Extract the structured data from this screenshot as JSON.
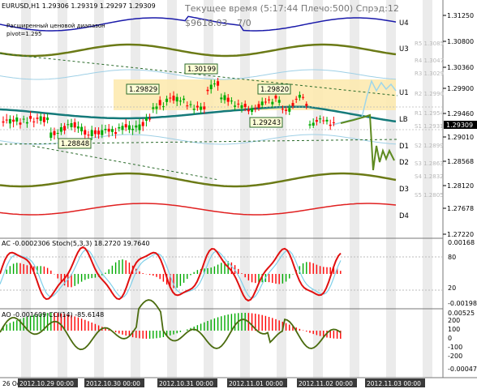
{
  "main": {
    "symbol_line": "EURUSD,H1  1.29306 1.29319 1.29297 1.29309",
    "overlay_time": "Текущее время (5:17:44 Плечо:500) Спрэд:12",
    "overlay_money": "$9618.03",
    "overlay_ratio": "7/0",
    "indicator_name": "Расширенный ценовой диапазон",
    "pivot": "pivot=1.295",
    "current_price": "1.29309",
    "price_ticks": [
      "1.31250",
      "1.30800",
      "1.30360",
      "1.29900",
      "1.29460",
      "1.29010",
      "1.28568",
      "1.28120",
      "1.27678",
      "1.27220"
    ],
    "level_labels": [
      "U4",
      "U3",
      "U1",
      "LB",
      "D1",
      "D2",
      "D3",
      "D4"
    ],
    "faint_labels": [
      "R5 1.3085",
      "R4 1.3047",
      "R3 1.3029",
      "R2 1.2990",
      "R1 1.2954",
      "S1 1.2931",
      "S2 1.2899",
      "S3 1.2863",
      "S4 1.2832",
      "S5 1.2805"
    ],
    "box_labels": [
      "1.30199",
      "1.29829",
      "1.29820",
      "1.29243",
      "1.28848"
    ]
  },
  "ac_panel": {
    "title": "AC -0.0002306  Stoch(5,3,3) 18.2720 19.7640",
    "ticks": [
      "0.00168",
      "80",
      "20",
      "-0.00198"
    ]
  },
  "ao_panel": {
    "title": "AO -0.001609  CCI(14) -85.6148",
    "ticks": [
      "0.00525",
      "200",
      "100",
      "0",
      "-100",
      "-200",
      "-0.00047"
    ]
  },
  "time_axis": [
    "26 Oct",
    "2012.10.29 00:00",
    "2012.10.30 00:00",
    "2012.10.31 00:00",
    "2012.11.01 00:00",
    "2012.11.02 00:00",
    "2012.11.03 00:00"
  ],
  "colors": {
    "candle_up": "#00aa00",
    "candle_down": "#ff0000",
    "teal": "#157a7a",
    "olive": "#6b7a16",
    "navy": "#1a1aaa",
    "red_band": "#e02020",
    "highlight": "#fdeab0"
  }
}
